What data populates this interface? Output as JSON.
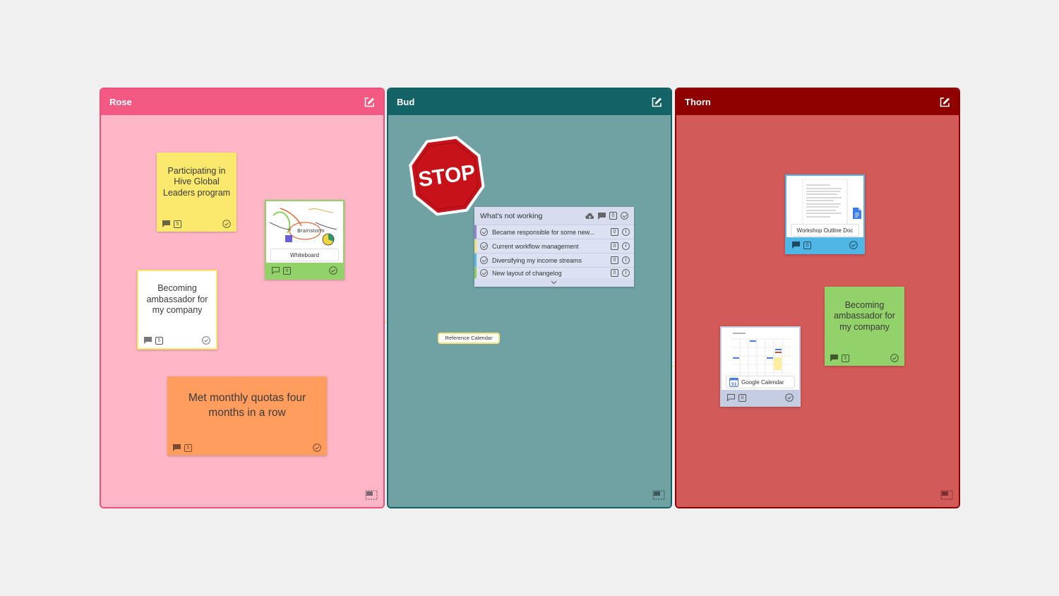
{
  "columns": [
    {
      "title": "Rose",
      "color": "#f35a83"
    },
    {
      "title": "Bud",
      "color": "#136265"
    },
    {
      "title": "Thorn",
      "color": "#8f0000"
    }
  ],
  "rose": {
    "sticky_hive": {
      "text": "Participating in Hive Global Leaders program",
      "badge": "5",
      "color": "#fae96d"
    },
    "sticky_ambassador": {
      "text": "Becoming ambassador for my company",
      "badge": "5",
      "color": "#ffffff"
    },
    "sticky_quotas": {
      "text": "Met monthly quotas four months in a row",
      "badge": "5",
      "color": "#ff9d5e"
    },
    "whiteboard": {
      "label": "Whiteboard",
      "badge": "0",
      "center_word": "Brainstorm"
    }
  },
  "bud": {
    "stop_sign": "STOP",
    "list": {
      "title": "What's not working",
      "badge": "0",
      "items": [
        {
          "text": "Became responsible for some new...",
          "badge": "0",
          "color": "#9b7fd9"
        },
        {
          "text": "Current workflow management",
          "badge": "0",
          "color": "#f4e07a"
        },
        {
          "text": "Diversifying my income streams",
          "badge": "0",
          "color": "#58b8e5"
        },
        {
          "text": "New layout of changelog",
          "badge": "0",
          "color": "#8ecb5d"
        }
      ]
    }
  },
  "thorn": {
    "doc": {
      "label": "Workshop Outline Doc",
      "badge": "0"
    },
    "calendar": {
      "label": "Google Calendar",
      "badge": "0",
      "icon_number": "31"
    },
    "sticky_ambassador": {
      "text": "Becoming ambassador for my company",
      "badge": "5",
      "color": "#93d26b"
    }
  },
  "connector": {
    "label": "Reference Calendar",
    "color": "#f6e27a"
  }
}
